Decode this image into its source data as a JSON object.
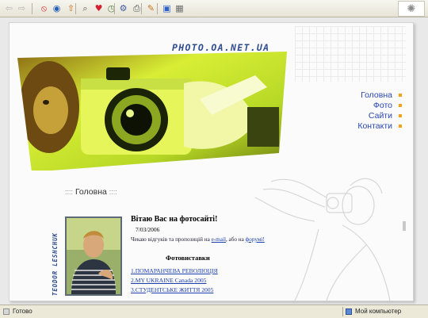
{
  "toolbar": {
    "buttons": [
      {
        "icon": "back-arrow-icon",
        "glyph": "⇦",
        "color": "#b5b5b5"
      },
      {
        "icon": "forward-arrow-icon",
        "glyph": "⇨",
        "color": "#b5b5b5"
      },
      {
        "icon": "stop-icon",
        "glyph": "⦸",
        "color": "#d31f1f"
      },
      {
        "icon": "home-globe-icon",
        "glyph": "◉",
        "color": "#2360b8"
      },
      {
        "icon": "up-arrow-icon",
        "glyph": "⇧",
        "color": "#d36c1a"
      },
      {
        "icon": "search-icon",
        "glyph": "⌕",
        "color": "#5a5a5a"
      },
      {
        "icon": "favorites-heart-icon",
        "glyph": "♥",
        "color": "#d4202f"
      },
      {
        "icon": "history-clock-icon",
        "glyph": "◷",
        "color": "#4c7a3c"
      },
      {
        "icon": "settings-icon",
        "glyph": "⚙",
        "color": "#3c5aa8"
      },
      {
        "icon": "print-icon",
        "glyph": "⎙",
        "color": "#555555"
      },
      {
        "icon": "edit-pen-icon",
        "glyph": "✎",
        "color": "#c7741f"
      },
      {
        "icon": "window-icon",
        "glyph": "▣",
        "color": "#2e62c9"
      },
      {
        "icon": "image-icon",
        "glyph": "▦",
        "color": "#6f6f6f"
      }
    ]
  },
  "site": {
    "logo": "PHOTO.OA.NET.UA",
    "author_vertical": "TEODOR LESHCHUK",
    "nav": [
      {
        "label": "Головна"
      },
      {
        "label": "Фото"
      },
      {
        "label": "Сайти"
      },
      {
        "label": "Контакти"
      }
    ],
    "section_title": "Головна",
    "section_dots": "::::",
    "welcome": "Вітаю Вас на фотосайті!",
    "date": "7/03/2006",
    "waiting_prefix": "Чекаю відгуків та пропозицій на ",
    "email_link": "e-mail",
    "waiting_middle": ", або на ",
    "forum_link": "форумі!",
    "exhibitions_title": "Фотовиставки",
    "exhibitions": [
      {
        "label": "1.ПОМАРАНЧЕВА РЕВОЛЮЦІЯ"
      },
      {
        "label": "2.MY UKRAINE Canada 2005"
      },
      {
        "label": "3.СТУДЕНТСЬКЕ ЖИТТЯ 2005"
      }
    ],
    "accent_color": "#f6a118",
    "link_color": "#2947b0"
  },
  "statusbar": {
    "left_text": "Готово",
    "right_text": "Мой компьютер"
  }
}
